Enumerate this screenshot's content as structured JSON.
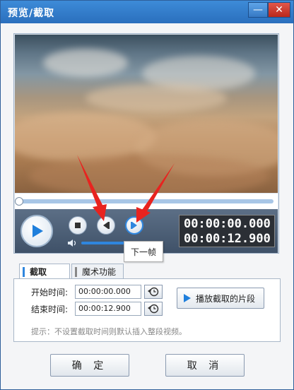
{
  "window": {
    "title": "预览/截取",
    "minimize_label": "—",
    "close_label": "✕"
  },
  "player": {
    "current_time": "00:00:00.000",
    "total_time": "00:00:12.900",
    "progress": 0,
    "volume": 0.75,
    "tooltip": "下一帧",
    "icons": [
      "play-icon",
      "stop-icon",
      "prev-frame-icon",
      "next-frame-icon",
      "volume-icon"
    ]
  },
  "tabs": [
    {
      "label": "截取"
    },
    {
      "label": "魔术功能"
    }
  ],
  "clip": {
    "start_label": "开始时间:",
    "start_value": "00:00:00.000",
    "end_label": "结束时间:",
    "end_value": "00:00:12.900",
    "play_segment_label": "播放截取的片段",
    "hint": "提示：不设置截取时间则默认插入整段视频。"
  },
  "footer": {
    "ok_label": "确 定",
    "cancel_label": "取 消"
  },
  "colors": {
    "title_bar": "#2f7fd0",
    "accent": "#2f86de",
    "annotation_arrow": "#e8231f"
  }
}
